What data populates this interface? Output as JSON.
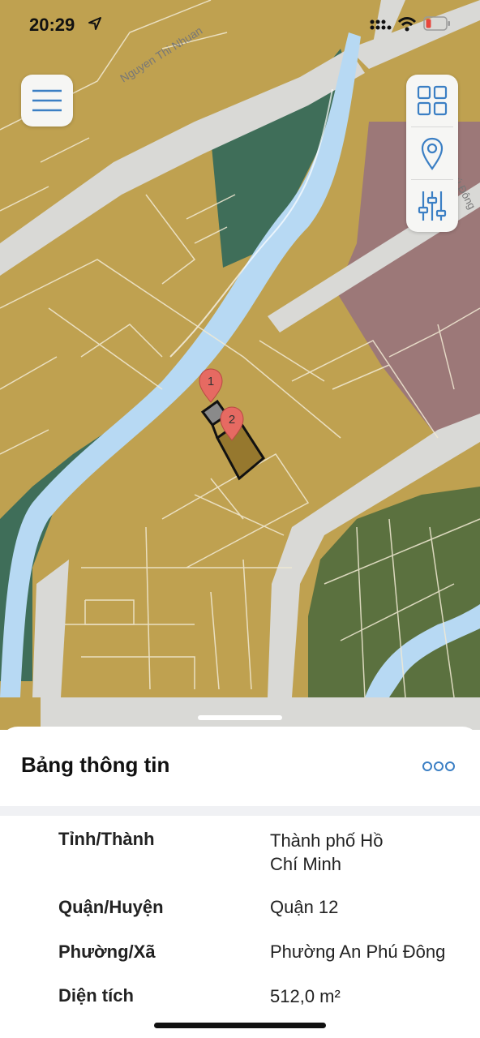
{
  "status_bar": {
    "time": "20:29"
  },
  "map": {
    "street_labels": [
      "Nguyen Thi Nhuan",
      "Phú Đông"
    ],
    "markers": [
      "1",
      "2"
    ],
    "colors": {
      "residential": "#bfa150",
      "green": "#3f6e59",
      "park": "#5b713f",
      "public": "#9c7878",
      "water": "#b7d9f3",
      "road": "#d9d9d6",
      "selected": "#96782e",
      "marker": "#e66a62"
    }
  },
  "controls": {
    "menu_icon": "hamburger-icon",
    "layers_icon": "grid-icon",
    "location_icon": "location-pin-icon",
    "filter_icon": "sliders-icon"
  },
  "panel": {
    "title": "Bảng thông tin",
    "more_icon": "more-dots-icon",
    "rows": [
      {
        "label": "Tỉnh/Thành",
        "value": "Thành phố Hồ\nChí Minh"
      },
      {
        "label": "Quận/Huyện",
        "value": "Quận 12"
      },
      {
        "label": "Phường/Xã",
        "value": "Phường An Phú Đông"
      },
      {
        "label": "Diện tích",
        "value": "512,0 m²"
      }
    ]
  }
}
